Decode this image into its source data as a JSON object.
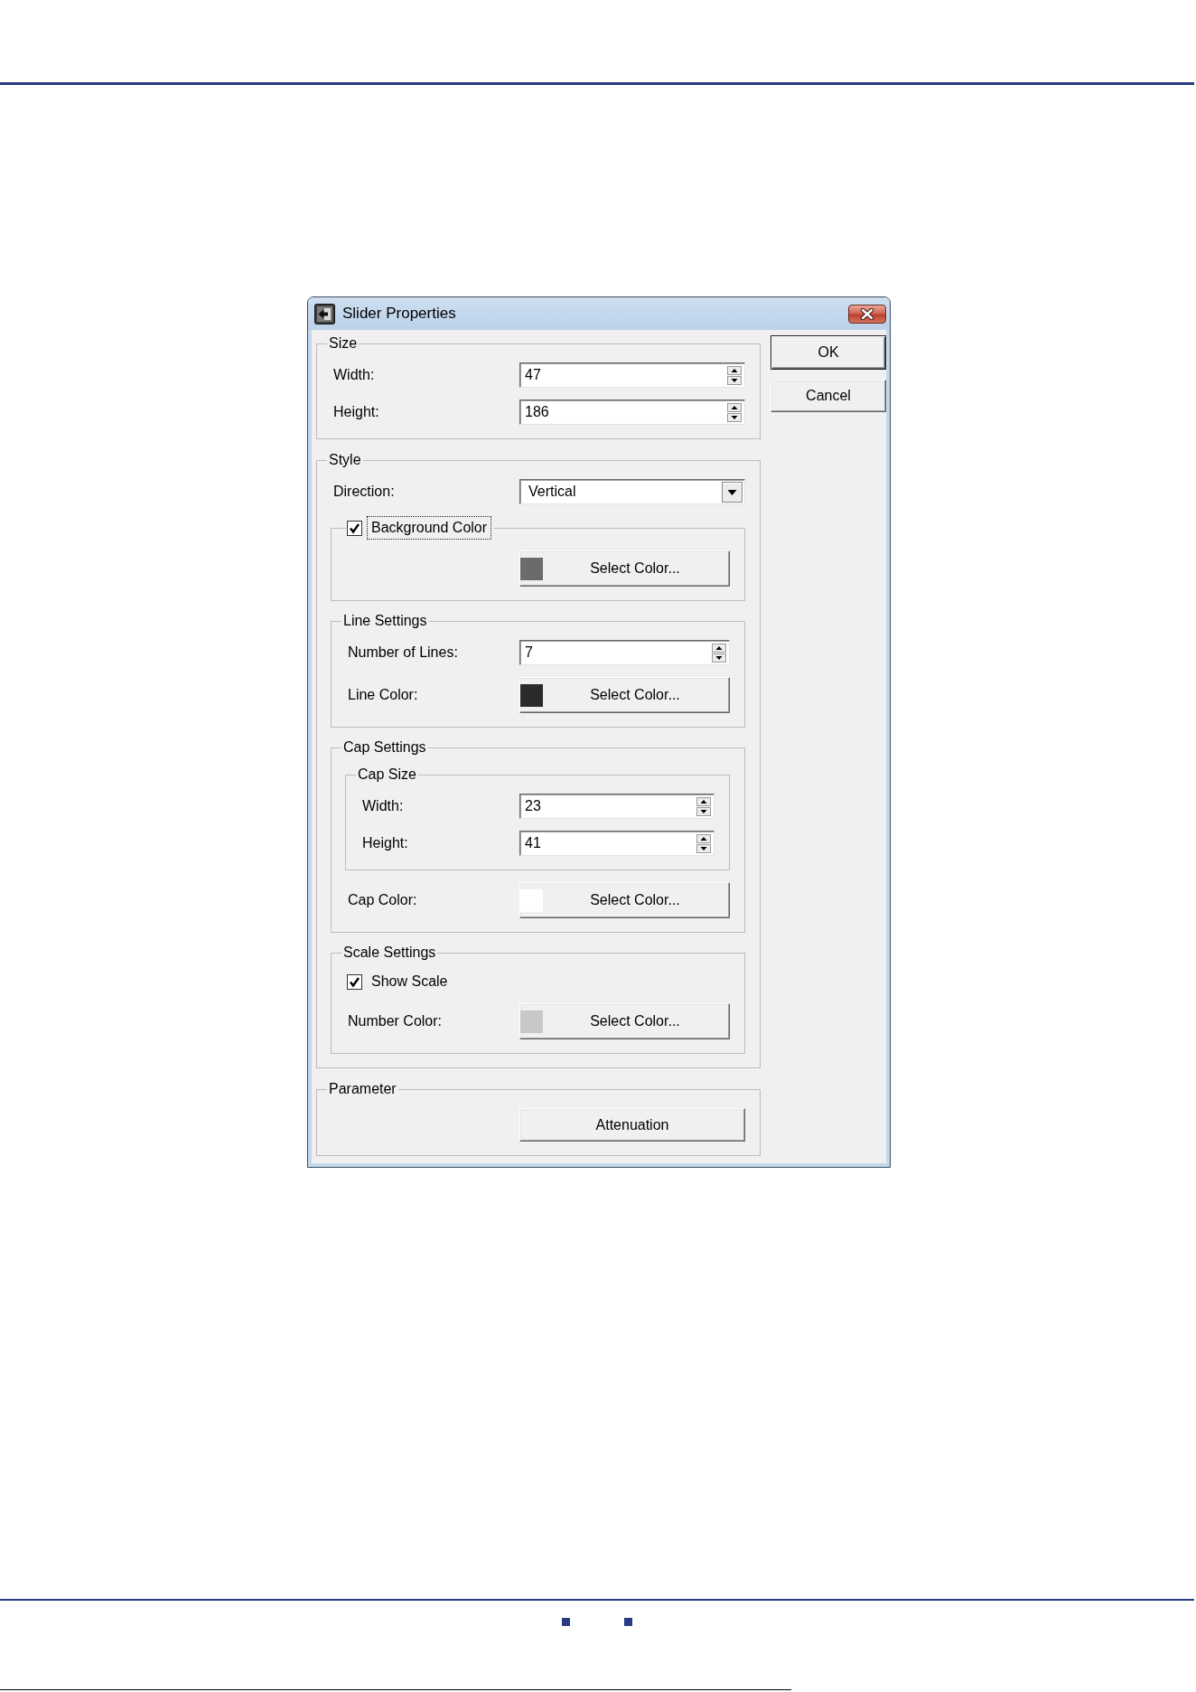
{
  "window": {
    "title": "Slider Properties"
  },
  "buttons": [
    {
      "label": "OK",
      "default": true
    },
    {
      "label": "Cancel",
      "default": false
    }
  ],
  "groups": [
    {
      "kind": "group",
      "title": "Size",
      "items": [
        {
          "kind": "spin",
          "label": "Width:",
          "value": "47"
        },
        {
          "kind": "spin",
          "label": "Height:",
          "value": "186"
        }
      ]
    },
    {
      "kind": "group",
      "title": "Style",
      "items": [
        {
          "kind": "dropdown",
          "label": "Direction:",
          "value": "Vertical"
        },
        {
          "kind": "checkgroup",
          "title": "Background Color",
          "checked": true,
          "focused": true,
          "items": [
            {
              "kind": "color",
              "button_label": "Select Color...",
              "color": "#6b6b6b"
            }
          ]
        },
        {
          "kind": "group",
          "title": "Line Settings",
          "items": [
            {
              "kind": "spin",
              "label": "Number of Lines:",
              "value": "7"
            },
            {
              "kind": "color",
              "label": "Line Color:",
              "button_label": "Select Color...",
              "color": "#2b2b2b"
            }
          ]
        },
        {
          "kind": "group",
          "title": "Cap Settings",
          "items": [
            {
              "kind": "group",
              "title": "Cap Size",
              "items": [
                {
                  "kind": "spin",
                  "label": "Width:",
                  "value": "23"
                },
                {
                  "kind": "spin",
                  "label": "Height:",
                  "value": "41"
                }
              ]
            },
            {
              "kind": "color",
              "label": "Cap Color:",
              "button_label": "Select Color...",
              "color": "#ffffff"
            }
          ]
        },
        {
          "kind": "group",
          "title": "Scale Settings",
          "items": [
            {
              "kind": "checkbox",
              "label": "Show Scale",
              "checked": true,
              "focused": false
            },
            {
              "kind": "color",
              "label": "Number Color:",
              "button_label": "Select Color...",
              "color": "#c8c8c8"
            }
          ]
        }
      ]
    },
    {
      "kind": "group",
      "title": "Parameter",
      "items": [
        {
          "kind": "button",
          "label": "Attenuation"
        }
      ]
    }
  ]
}
